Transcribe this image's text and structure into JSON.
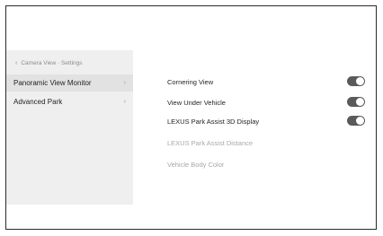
{
  "sidebar": {
    "breadcrumb": {
      "chevron": "‹",
      "text": "Camera View · Settings"
    },
    "items": [
      {
        "label": "Panoramic View Monitor",
        "arrow": "›",
        "active": true
      },
      {
        "label": "Advanced Park",
        "arrow": "›",
        "active": false
      }
    ]
  },
  "settings": [
    {
      "label": "Cornering View",
      "toggle": true,
      "on": true,
      "enabled": true
    },
    {
      "label": "View Under Vehicle",
      "toggle": true,
      "on": true,
      "enabled": true
    },
    {
      "label": "LEXUS Park Assist 3D Display",
      "toggle": true,
      "on": true,
      "enabled": true
    },
    {
      "label": "LEXUS Park Assist Distance",
      "toggle": false,
      "enabled": false
    },
    {
      "label": "Vehicle Body Color",
      "toggle": false,
      "enabled": false
    }
  ],
  "colors": {
    "toggle_on": "#5a5a5a",
    "sidebar_bg": "#efefef",
    "active_item_bg": "#e2e2e2",
    "disabled_text": "#a8a8a8"
  }
}
